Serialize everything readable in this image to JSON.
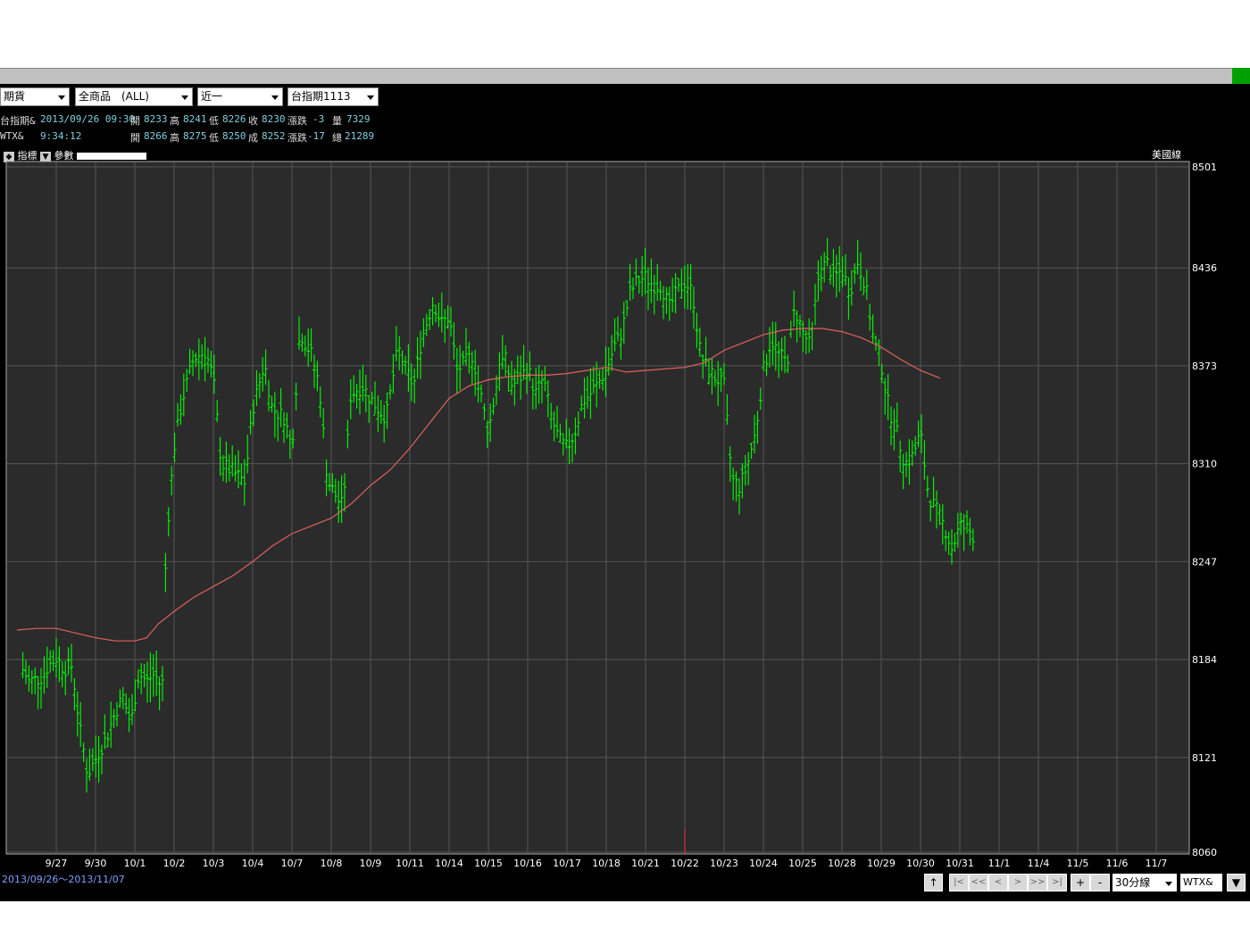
{
  "toolbar": {
    "market": "期貨",
    "product": "全商品　(ALL)",
    "period": "近一",
    "contract": "台指期1113"
  },
  "quote1": {
    "name": "台指期&",
    "datetime": "2013/09/26 09:30",
    "open_label": "開",
    "open": "8233",
    "high_label": "高",
    "high": "8241",
    "low_label": "低",
    "low": "8226",
    "close_label": "收",
    "close": "8230",
    "chg_label": "漲跌",
    "chg": "-3",
    "vol_label": "量",
    "vol": "7329"
  },
  "quote2": {
    "name": "WTX&",
    "time": "9:34:12",
    "open_label": "開",
    "open": "8266",
    "high_label": "高",
    "high": "8275",
    "low_label": "低",
    "low": "8250",
    "close_label": "成",
    "close": "8252",
    "chg_label": "漲跌",
    "chg": "-17",
    "vol_label": "總",
    "vol": "21289"
  },
  "tabs": {
    "indicator": "指標",
    "params": "參數"
  },
  "chart_style_label": "美國線",
  "date_range": "2013/09/26～2013/11/07",
  "bottom": {
    "up": "↑",
    "first": "|<",
    "prev_page": "<<",
    "prev": "<",
    "next": ">",
    "next_page": ">>",
    "last": ">|",
    "zoom_in": "+",
    "zoom_out": "-",
    "interval": "30分線",
    "symbol": "WTX&",
    "menu": "▼"
  },
  "colors": {
    "bars": "#00ff00",
    "ma": "#e06060",
    "bg": "#000000",
    "plot_bg": "#2b2b2b",
    "grid": "#555555"
  },
  "chart_data": {
    "type": "ohlc",
    "ylim": [
      8060,
      8501
    ],
    "yticks": [
      "8501",
      "8436",
      "8373",
      "8310",
      "8247",
      "8184",
      "8121",
      "8060"
    ],
    "categories": [
      "9/27",
      "9/30",
      "10/1",
      "10/2",
      "10/3",
      "10/4",
      "10/7",
      "10/8",
      "10/9",
      "10/11",
      "10/14",
      "10/15",
      "10/16",
      "10/17",
      "10/18",
      "10/21",
      "10/22",
      "10/23",
      "10/24",
      "10/25",
      "10/28",
      "10/29",
      "10/30",
      "10/31",
      "11/1",
      "11/4",
      "11/5",
      "11/6",
      "11/7"
    ],
    "close_path": [
      [
        -0.9,
        8180
      ],
      [
        -0.7,
        8170
      ],
      [
        -0.4,
        8172
      ],
      [
        -0.2,
        8180
      ],
      [
        0,
        8185
      ],
      [
        0.2,
        8178
      ],
      [
        0.4,
        8180
      ],
      [
        0.6,
        8140
      ],
      [
        0.8,
        8110
      ],
      [
        1.1,
        8125
      ],
      [
        1.3,
        8135
      ],
      [
        1.5,
        8150
      ],
      [
        1.7,
        8160
      ],
      [
        1.9,
        8142
      ],
      [
        2.1,
        8175
      ],
      [
        2.3,
        8170
      ],
      [
        2.5,
        8175
      ],
      [
        2.7,
        8165
      ],
      [
        2.8,
        8260
      ],
      [
        3.0,
        8320
      ],
      [
        3.2,
        8350
      ],
      [
        3.5,
        8378
      ],
      [
        3.8,
        8382
      ],
      [
        4.0,
        8365
      ],
      [
        4.2,
        8310
      ],
      [
        4.5,
        8305
      ],
      [
        4.8,
        8298
      ],
      [
        5.0,
        8345
      ],
      [
        5.3,
        8375
      ],
      [
        5.5,
        8345
      ],
      [
        5.8,
        8340
      ],
      [
        6.0,
        8320
      ],
      [
        6.2,
        8395
      ],
      [
        6.5,
        8380
      ],
      [
        6.7,
        8360
      ],
      [
        6.9,
        8300
      ],
      [
        7.1,
        8290
      ],
      [
        7.3,
        8282
      ],
      [
        7.5,
        8355
      ],
      [
        7.8,
        8360
      ],
      [
        8.0,
        8352
      ],
      [
        8.2,
        8345
      ],
      [
        8.4,
        8340
      ],
      [
        8.7,
        8385
      ],
      [
        8.9,
        8370
      ],
      [
        9.1,
        8360
      ],
      [
        9.3,
        8390
      ],
      [
        9.6,
        8415
      ],
      [
        9.8,
        8400
      ],
      [
        10.0,
        8405
      ],
      [
        10.2,
        8370
      ],
      [
        10.4,
        8375
      ],
      [
        10.6,
        8380
      ],
      [
        10.8,
        8355
      ],
      [
        11.0,
        8330
      ],
      [
        11.2,
        8360
      ],
      [
        11.4,
        8380
      ],
      [
        11.6,
        8360
      ],
      [
        11.8,
        8365
      ],
      [
        12.0,
        8372
      ],
      [
        12.2,
        8355
      ],
      [
        12.4,
        8365
      ],
      [
        12.6,
        8340
      ],
      [
        12.8,
        8325
      ],
      [
        13.0,
        8320
      ],
      [
        13.2,
        8330
      ],
      [
        13.4,
        8350
      ],
      [
        13.6,
        8355
      ],
      [
        13.8,
        8362
      ],
      [
        14.0,
        8370
      ],
      [
        14.2,
        8385
      ],
      [
        14.4,
        8395
      ],
      [
        14.6,
        8420
      ],
      [
        14.8,
        8428
      ],
      [
        15.0,
        8430
      ],
      [
        15.2,
        8425
      ],
      [
        15.4,
        8425
      ],
      [
        15.6,
        8410
      ],
      [
        15.8,
        8420
      ],
      [
        16.0,
        8427
      ],
      [
        16.2,
        8420
      ],
      [
        16.4,
        8380
      ],
      [
        16.6,
        8370
      ],
      [
        16.8,
        8365
      ],
      [
        17.0,
        8360
      ],
      [
        17.2,
        8300
      ],
      [
        17.4,
        8295
      ],
      [
        17.6,
        8310
      ],
      [
        17.8,
        8330
      ],
      [
        18.0,
        8370
      ],
      [
        18.2,
        8390
      ],
      [
        18.4,
        8380
      ],
      [
        18.6,
        8375
      ],
      [
        18.8,
        8410
      ],
      [
        19.0,
        8395
      ],
      [
        19.2,
        8385
      ],
      [
        19.4,
        8430
      ],
      [
        19.6,
        8440
      ],
      [
        19.8,
        8430
      ],
      [
        20.0,
        8435
      ],
      [
        20.2,
        8420
      ],
      [
        20.4,
        8440
      ],
      [
        20.6,
        8425
      ],
      [
        20.8,
        8390
      ],
      [
        21.0,
        8375
      ],
      [
        21.2,
        8345
      ],
      [
        21.4,
        8330
      ],
      [
        21.6,
        8310
      ],
      [
        21.8,
        8315
      ],
      [
        22.0,
        8330
      ],
      [
        22.2,
        8290
      ],
      [
        22.4,
        8280
      ],
      [
        22.6,
        8270
      ],
      [
        22.8,
        8255
      ],
      [
        23.0,
        8270
      ],
      [
        23.2,
        8268
      ],
      [
        23.4,
        8262
      ]
    ],
    "ma_path": [
      [
        -1,
        8203
      ],
      [
        -0.5,
        8204
      ],
      [
        0,
        8204
      ],
      [
        0.5,
        8201
      ],
      [
        1,
        8198
      ],
      [
        1.5,
        8196
      ],
      [
        2,
        8196
      ],
      [
        2.3,
        8198
      ],
      [
        2.6,
        8207
      ],
      [
        3,
        8215
      ],
      [
        3.5,
        8224
      ],
      [
        4,
        8231
      ],
      [
        4.5,
        8238
      ],
      [
        5,
        8247
      ],
      [
        5.5,
        8257
      ],
      [
        6,
        8265
      ],
      [
        6.5,
        8270
      ],
      [
        7,
        8275
      ],
      [
        7.5,
        8284
      ],
      [
        8,
        8296
      ],
      [
        8.5,
        8306
      ],
      [
        9,
        8320
      ],
      [
        9.5,
        8336
      ],
      [
        10,
        8352
      ],
      [
        10.5,
        8360
      ],
      [
        11,
        8364
      ],
      [
        11.5,
        8366
      ],
      [
        12,
        8367
      ],
      [
        12.5,
        8367
      ],
      [
        13,
        8368
      ],
      [
        13.5,
        8370
      ],
      [
        14,
        8372
      ],
      [
        14.5,
        8369
      ],
      [
        15,
        8370
      ],
      [
        15.5,
        8371
      ],
      [
        16,
        8372
      ],
      [
        16.5,
        8375
      ],
      [
        17,
        8383
      ],
      [
        17.5,
        8388
      ],
      [
        18,
        8393
      ],
      [
        18.5,
        8396
      ],
      [
        19,
        8397
      ],
      [
        19.5,
        8397
      ],
      [
        20,
        8395
      ],
      [
        20.5,
        8391
      ],
      [
        21,
        8385
      ],
      [
        21.5,
        8377
      ],
      [
        22,
        8370
      ],
      [
        22.5,
        8365
      ]
    ]
  }
}
